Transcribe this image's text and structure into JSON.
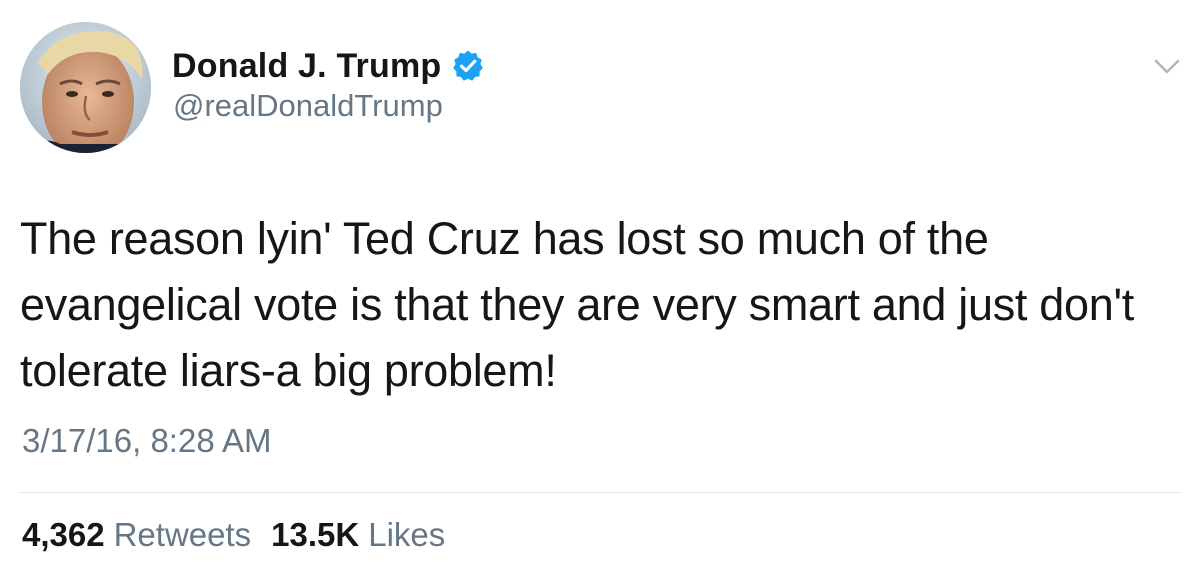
{
  "tweet": {
    "author": {
      "display_name": "Donald J. Trump",
      "handle": "@realDonaldTrump",
      "verified": true
    },
    "text": "The reason lyin' Ted Cruz has lost so much of the evangelical vote is that they are very smart and just don't tolerate liars-a big problem!",
    "timestamp": "3/17/16, 8:28 AM",
    "stats": {
      "retweets_count": "4,362",
      "retweets_label": "Retweets",
      "likes_count": "13.5K",
      "likes_label": "Likes"
    }
  },
  "icons": {
    "verified": "verified-badge-icon",
    "menu": "chevron-down-icon",
    "avatar": "profile-avatar"
  },
  "colors": {
    "verified_blue": "#1da1f2",
    "secondary_text": "#657786",
    "primary_text": "#14171a",
    "divider": "#e1e8ed"
  }
}
